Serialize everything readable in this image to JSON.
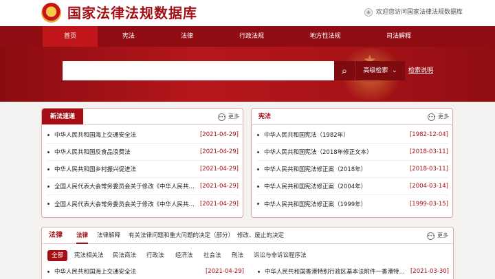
{
  "header": {
    "site_title": "国家法律法规数据库",
    "welcome": "欢迎您访问国家法律法规数据库"
  },
  "nav": {
    "items": [
      {
        "label": "首页",
        "active": true
      },
      {
        "label": "宪法"
      },
      {
        "label": "法律"
      },
      {
        "label": "行政法规"
      },
      {
        "label": "地方性法规"
      },
      {
        "label": "司法解释"
      }
    ]
  },
  "search": {
    "placeholder": "",
    "advanced_label": "高级检索",
    "help_label": "检索说明"
  },
  "news_panel": {
    "title": "新法速递",
    "more": "更多",
    "rows": [
      {
        "title": "中华人民共和国海上交通安全法",
        "date": "[2021-04-29]"
      },
      {
        "title": "中华人民共和国反食品浪费法",
        "date": "[2021-04-29]"
      },
      {
        "title": "中华人民共和国乡村振兴促进法",
        "date": "[2021-04-29]"
      },
      {
        "title": "全国人民代表大会常务委员会关于修改《中华人民共和…",
        "date": "[2021-04-29]"
      },
      {
        "title": "全国人民代表大会常务委员会关于修改《中华人民共和…",
        "date": "[2021-04-29]"
      }
    ]
  },
  "constitution_panel": {
    "title": "宪法",
    "more": "更多",
    "rows": [
      {
        "title": "中华人民共和国宪法（1982年）",
        "date": "[1982-12-04]"
      },
      {
        "title": "中华人民共和国宪法（2018年修正文本）",
        "date": "[2018-03-11]"
      },
      {
        "title": "中华人民共和国宪法修正案（2018年）",
        "date": "[2018-03-11]"
      },
      {
        "title": "中华人民共和国宪法修正案（2004年）",
        "date": "[2004-03-14]"
      },
      {
        "title": "中华人民共和国宪法修正案（1999年）",
        "date": "[1999-03-15]"
      }
    ]
  },
  "law_panel": {
    "title": "法律",
    "more": "更多",
    "tabs": [
      "法律",
      "法律解释",
      "有关法律问题和重大问题的决定（部分）",
      "修改、废止的决定"
    ],
    "chips": [
      "全部",
      "宪法相关法",
      "民法商法",
      "行政法",
      "经济法",
      "社会法",
      "刑法",
      "诉讼与非诉讼程序法"
    ],
    "rows_left": [
      {
        "title": "中华人民共和国海上交通安全法",
        "date": "[2021-04-29]"
      }
    ],
    "rows_right": [
      {
        "title": "中华人民共和国香港特别行政区基本法附件一香港特别…",
        "date": "[2021-03-30]"
      }
    ]
  },
  "colors": {
    "brand_red": "#a30f14",
    "nav_dark_red": "#8f0d12",
    "active_nav": "#c0151a"
  }
}
